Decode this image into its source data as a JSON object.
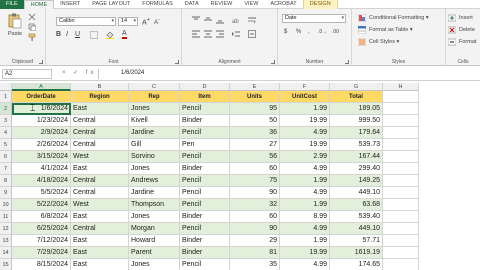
{
  "ribbon_tabs": [
    "FILE",
    "HOME",
    "INSERT",
    "PAGE LAYOUT",
    "FORMULAS",
    "DATA",
    "REVIEW",
    "VIEW",
    "ACROBAT",
    "DESIGN"
  ],
  "ribbon": {
    "clipboard": {
      "paste_label": "Paste",
      "group_label": "Clipboard"
    },
    "font": {
      "font_name": "Calibri",
      "font_size": "14",
      "group_label": "Font"
    },
    "alignment": {
      "group_label": "Alignment"
    },
    "number": {
      "format": "Date",
      "group_label": "Number"
    },
    "styles": {
      "conditional": "Conditional Formatting",
      "format_table": "Format as Table",
      "cell_styles": "Cell Styles",
      "group_label": "Styles"
    },
    "cells": {
      "insert": "Insert",
      "delete": "Delete",
      "format": "Format",
      "group_label": "Cells"
    }
  },
  "formula_bar": {
    "name_box": "A2",
    "fx_icons": "× ✓ fx",
    "formula": "1/6/2024"
  },
  "columns": [
    "A",
    "B",
    "C",
    "D",
    "E",
    "F",
    "G",
    "H"
  ],
  "table": {
    "headers": [
      "OrderDate",
      "Region",
      "Rep",
      "Item",
      "Units",
      "UnitCost",
      "Total"
    ],
    "rows": [
      [
        "1/6/2024",
        "East",
        "Jones",
        "Pencil",
        "95",
        "1.99",
        "189.05"
      ],
      [
        "1/23/2024",
        "Central",
        "Kivell",
        "Binder",
        "50",
        "19.99",
        "999.50"
      ],
      [
        "2/9/2024",
        "Central",
        "Jardine",
        "Pencil",
        "36",
        "4.99",
        "179.64"
      ],
      [
        "2/26/2024",
        "Central",
        "Gill",
        "Pen",
        "27",
        "19.99",
        "539.73"
      ],
      [
        "3/15/2024",
        "West",
        "Sorvino",
        "Pencil",
        "56",
        "2.99",
        "167.44"
      ],
      [
        "4/1/2024",
        "East",
        "Jones",
        "Binder",
        "60",
        "4.99",
        "299.40"
      ],
      [
        "4/18/2024",
        "Central",
        "Andrews",
        "Pencil",
        "75",
        "1.99",
        "149.25"
      ],
      [
        "5/5/2024",
        "Central",
        "Jardine",
        "Pencil",
        "90",
        "4.99",
        "449.10"
      ],
      [
        "5/22/2024",
        "West",
        "Thompson",
        "Pencil",
        "32",
        "1.99",
        "63.68"
      ],
      [
        "6/8/2024",
        "East",
        "Jones",
        "Binder",
        "60",
        "8.99",
        "539.40"
      ],
      [
        "6/25/2024",
        "Central",
        "Morgan",
        "Pencil",
        "90",
        "4.99",
        "449.10"
      ],
      [
        "7/12/2024",
        "East",
        "Howard",
        "Binder",
        "29",
        "1.99",
        "57.71"
      ],
      [
        "7/29/2024",
        "East",
        "Parent",
        "Binder",
        "81",
        "19.99",
        "1619.19"
      ],
      [
        "8/15/2024",
        "East",
        "Jones",
        "Pencil",
        "35",
        "4.99",
        "174.65"
      ]
    ]
  },
  "colors": {
    "excel_green": "#217346",
    "header_fill": "#ffd966",
    "band_fill": "#e2efda"
  }
}
